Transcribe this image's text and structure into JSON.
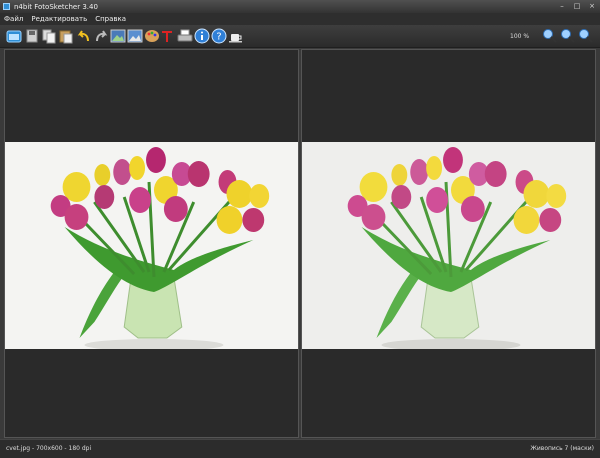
{
  "window": {
    "title": "n4bit FotoSketcher 3.40",
    "minimize": "–",
    "maximize": "□",
    "close": "×"
  },
  "menu": {
    "items": [
      "Файл",
      "Редактировать",
      "Справка"
    ]
  },
  "toolbar": {
    "zoom": "100 %",
    "icons": [
      "open-image-icon",
      "save-icon",
      "copy-icon",
      "paste-icon",
      "undo-icon",
      "redo-icon",
      "original-view-icon",
      "result-view-icon",
      "palette-icon",
      "add-text-icon",
      "print-icon",
      "info-icon",
      "help-icon",
      "coffee-icon",
      "zoom-in-icon",
      "zoom-out-icon",
      "zoom-fit-icon"
    ]
  },
  "status": {
    "left": "cvet.jpg - 700x600 - 180 dpi",
    "right": "Живопись 7 (маски)"
  },
  "colors": {
    "background": "#3a3a3a",
    "panel": "#2a2a2a",
    "accent": "#2f8fd6"
  }
}
